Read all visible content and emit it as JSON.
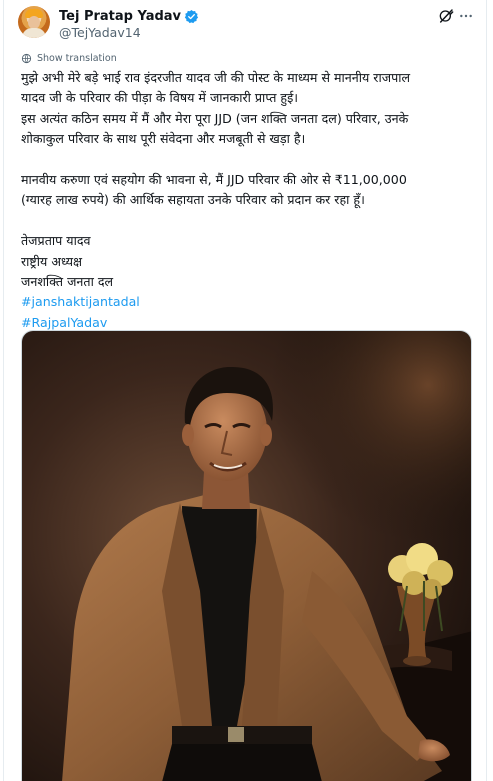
{
  "author": {
    "name": "Tej Pratap Yadav",
    "handle": "@TejYadav14",
    "verified": true
  },
  "icons": {
    "verified": "verified-badge-icon",
    "grok": "grok-icon",
    "more": "more-options-icon",
    "translate": "globe-translate-icon"
  },
  "translate_label": "Show translation",
  "post": {
    "lines": [
      "मुझे अभी मेरे बड़े भाई राव इंदरजीत यादव जी की पोस्ट के माध्यम से माननीय राजपाल",
      "यादव जी के परिवार की पीड़ा के विषय में जानकारी प्राप्त हुई।",
      "इस अत्यंत कठिन समय में मैं और मेरा पूरा JJD (जन शक्ति जनता दल) परिवार, उनके",
      "शोकाकुल परिवार के साथ पूरी संवेदना और मजबूती से खड़ा है।"
    ],
    "lines2": [
      "मानवीय करुणा एवं सहयोग की भावना से, मैं JJD परिवार की ओर से ₹11,00,000",
      "(ग्यारह लाख रुपये) की आर्थिक सहायता उनके परिवार को प्रदान कर रहा हूँ।"
    ],
    "signature": [
      "तेजप्रताप यादव",
      "राष्ट्रीय अध्यक्ष",
      "जनशक्ति जनता दल"
    ],
    "hashtags": [
      "#janshaktijantadal",
      "#RajpalYadav"
    ]
  },
  "colors": {
    "link": "#1d9bf0",
    "verified": "#1d9bf0",
    "secondary_text": "#536471"
  }
}
